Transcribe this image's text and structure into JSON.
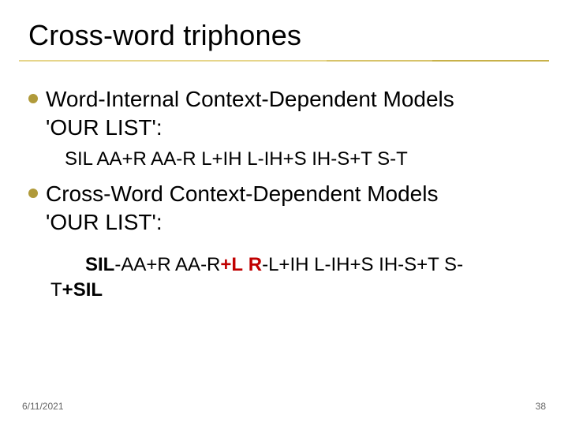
{
  "title": "Cross-word triphones",
  "bullets": [
    {
      "lead": "Word-Internal Context-Dependent Models",
      "cont": "'OUR LIST':",
      "sub": "SIL AA+R AA-R L+IH L-IH+S IH-S+T S-T"
    },
    {
      "lead": "Cross-Word Context-Dependent Models",
      "cont": " 'OUR LIST':",
      "sub_parts": [
        {
          "t": "SIL",
          "c": "hlb"
        },
        {
          "t": "-AA+R ",
          "c": ""
        },
        {
          "t": "AA-R",
          "c": ""
        },
        {
          "t": "+L",
          "c": "hlr"
        },
        {
          "t": " ",
          "c": ""
        },
        {
          "t": "R",
          "c": "hlr"
        },
        {
          "t": "-L+IH L-IH+S IH-S+T S-",
          "c": ""
        }
      ],
      "sub_wrap_parts": [
        {
          "t": "T",
          "c": ""
        },
        {
          "t": "+SIL",
          "c": "hlb"
        }
      ]
    }
  ],
  "footer": {
    "date": "6/11/2021",
    "page": "38"
  }
}
